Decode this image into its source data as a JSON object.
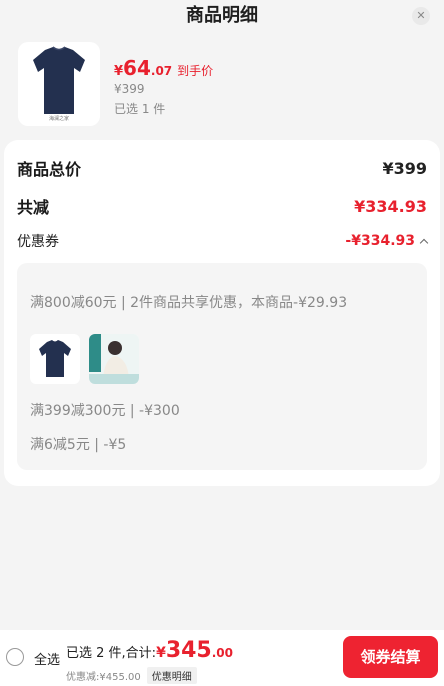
{
  "header": {
    "title": "商品明细"
  },
  "product": {
    "price_currency": "¥",
    "price_int": "64",
    "price_dec": ".07",
    "price_tag": "到手价",
    "original_price": "¥399",
    "selected_count": "已选 1 件",
    "thumb_label": "海澜之家"
  },
  "summary": {
    "total_label": "商品总价",
    "total_value": "¥399",
    "reduce_label": "共减",
    "reduce_value": "¥334.93",
    "coupon_label": "优惠券",
    "coupon_value": "-¥334.93"
  },
  "coupon_detail": {
    "line1": "满800减60元 | 2件商品共享优惠，本商品-¥29.93",
    "line2": "满399减300元 | -¥300",
    "line3": "满6减5元 | -¥5"
  },
  "bottom": {
    "select_all": "全选",
    "selected_summary": "已选 2 件,合计:",
    "total_currency": "¥",
    "total_int": "345",
    "total_dec": ".00",
    "discount_text": "优惠减:¥455.00",
    "detail_label": "优惠明细",
    "checkout_label": "领券结算"
  },
  "colors": {
    "accent": "#ee2331",
    "price_red": "#e8212e",
    "tshirt": "#23304f"
  },
  "icons": [
    "close-icon",
    "chevron-up-icon",
    "radio-icon"
  ]
}
